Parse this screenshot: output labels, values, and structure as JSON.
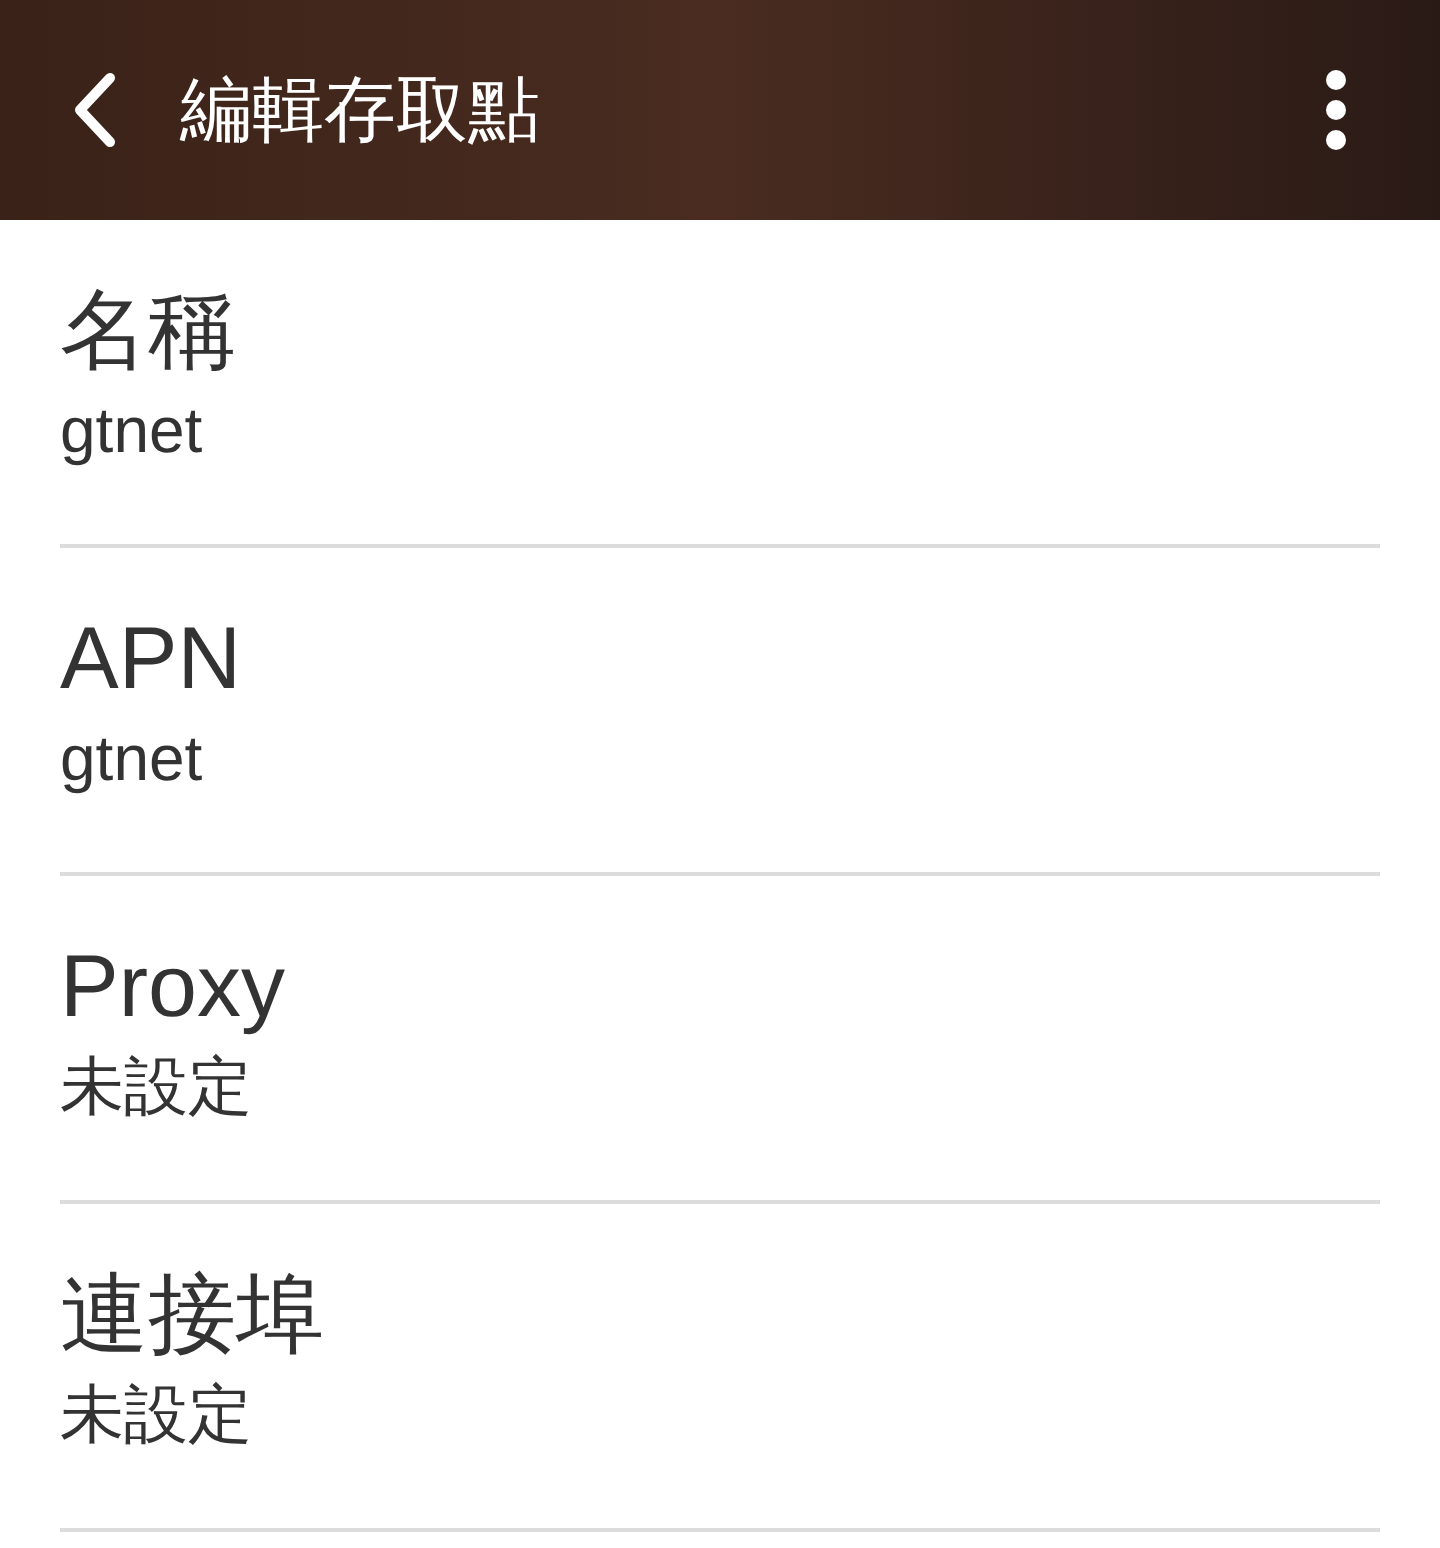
{
  "header": {
    "title": "編輯存取點"
  },
  "items": [
    {
      "title": "名稱",
      "value": "gtnet"
    },
    {
      "title": "APN",
      "value": "gtnet"
    },
    {
      "title": "Proxy",
      "value": "未設定"
    },
    {
      "title": "連接埠",
      "value": "未設定"
    }
  ]
}
